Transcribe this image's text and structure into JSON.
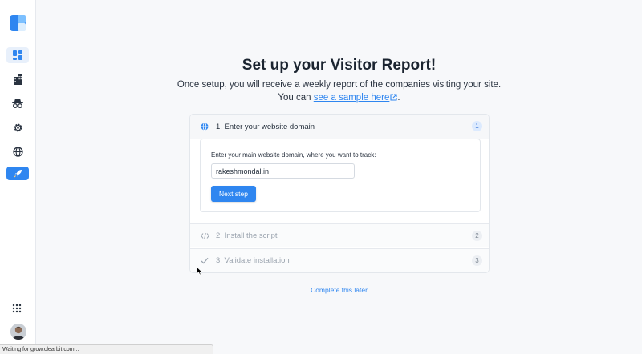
{
  "colors": {
    "accent": "#2f86f0",
    "sidebar_bg": "#ffffff",
    "page_bg": "#f7f8fa"
  },
  "sidebar": {
    "logo": "clearbit-logo",
    "items": [
      {
        "icon": "dashboard-icon",
        "state": "selected"
      },
      {
        "icon": "buildings-icon"
      },
      {
        "icon": "visitor-spy-icon"
      },
      {
        "icon": "gear-icon"
      },
      {
        "icon": "globe-icon"
      },
      {
        "icon": "rocket-icon",
        "state": "primary"
      }
    ],
    "apps_icon": "apps-grid-icon",
    "avatar": "user-avatar"
  },
  "main": {
    "title": "Set up your Visitor Report!",
    "subtitle_line1": "Once setup, you will receive a weekly report of the companies visiting your site.",
    "subtitle_prefix": "You can ",
    "sample_link": "see a sample here",
    "subtitle_suffix": ".",
    "steps": [
      {
        "label": "1. Enter your website domain",
        "number": "1",
        "icon": "globe-icon",
        "state": "active"
      },
      {
        "label": "2. Install the script",
        "number": "2",
        "icon": "code-icon",
        "state": "pending"
      },
      {
        "label": "3. Validate installation",
        "number": "3",
        "icon": "check-icon",
        "state": "pending"
      }
    ],
    "domain_prompt": "Enter your main website domain, where you want to track:",
    "domain_value": "rakeshmondal.in",
    "next_label": "Next step",
    "later_link": "Complete this later"
  },
  "status_bar": "Waiting for grow.clearbit.com..."
}
